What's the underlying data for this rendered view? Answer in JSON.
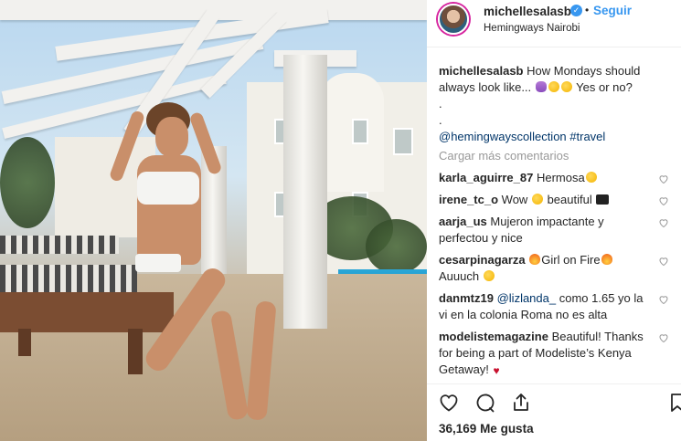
{
  "post": {
    "username": "michellesalasb",
    "follow_label": "Seguir",
    "separator": "•",
    "location": "Hemingways Nairobi",
    "caption": {
      "author": "michellesalasb",
      "text": "How Mondays should always look like...",
      "text_after_emoji": "Yes or no?",
      "dot1": ".",
      "dot2": ".",
      "mention": "@hemingwayscollection",
      "hashtag": "#travel"
    },
    "load_more": "Cargar más comentarios",
    "likes_count": "36,169",
    "likes_label": "Me gusta"
  },
  "comments": [
    {
      "user": "karla_aguirre_87",
      "text": "Hermosa"
    },
    {
      "user": "irene_tc_o",
      "text": "Wow",
      "text2": "beautiful"
    },
    {
      "user": "aarja_us",
      "text": "Mujeron impactante y perfectou y nice"
    },
    {
      "user": "cesarpinagarza",
      "text": "Girl on Fire",
      "text2": "Auuuch"
    },
    {
      "user": "danmtz19",
      "mention": "@lizlanda_",
      "text": "como 1.65 yo la vi en la colonia Roma no es alta"
    },
    {
      "user": "modelistemagazine",
      "text": "Beautiful! Thanks for being a part of Modeliste’s Kenya Getaway!"
    }
  ],
  "icons": {
    "verified": "verified-badge-icon",
    "like": "heart-icon",
    "comment": "comment-bubble-icon",
    "share": "share-icon",
    "comment_like": "heart-outline-icon"
  },
  "colors": {
    "link": "#003569",
    "follow": "#3897f0",
    "muted": "#999999",
    "text": "#262626"
  }
}
